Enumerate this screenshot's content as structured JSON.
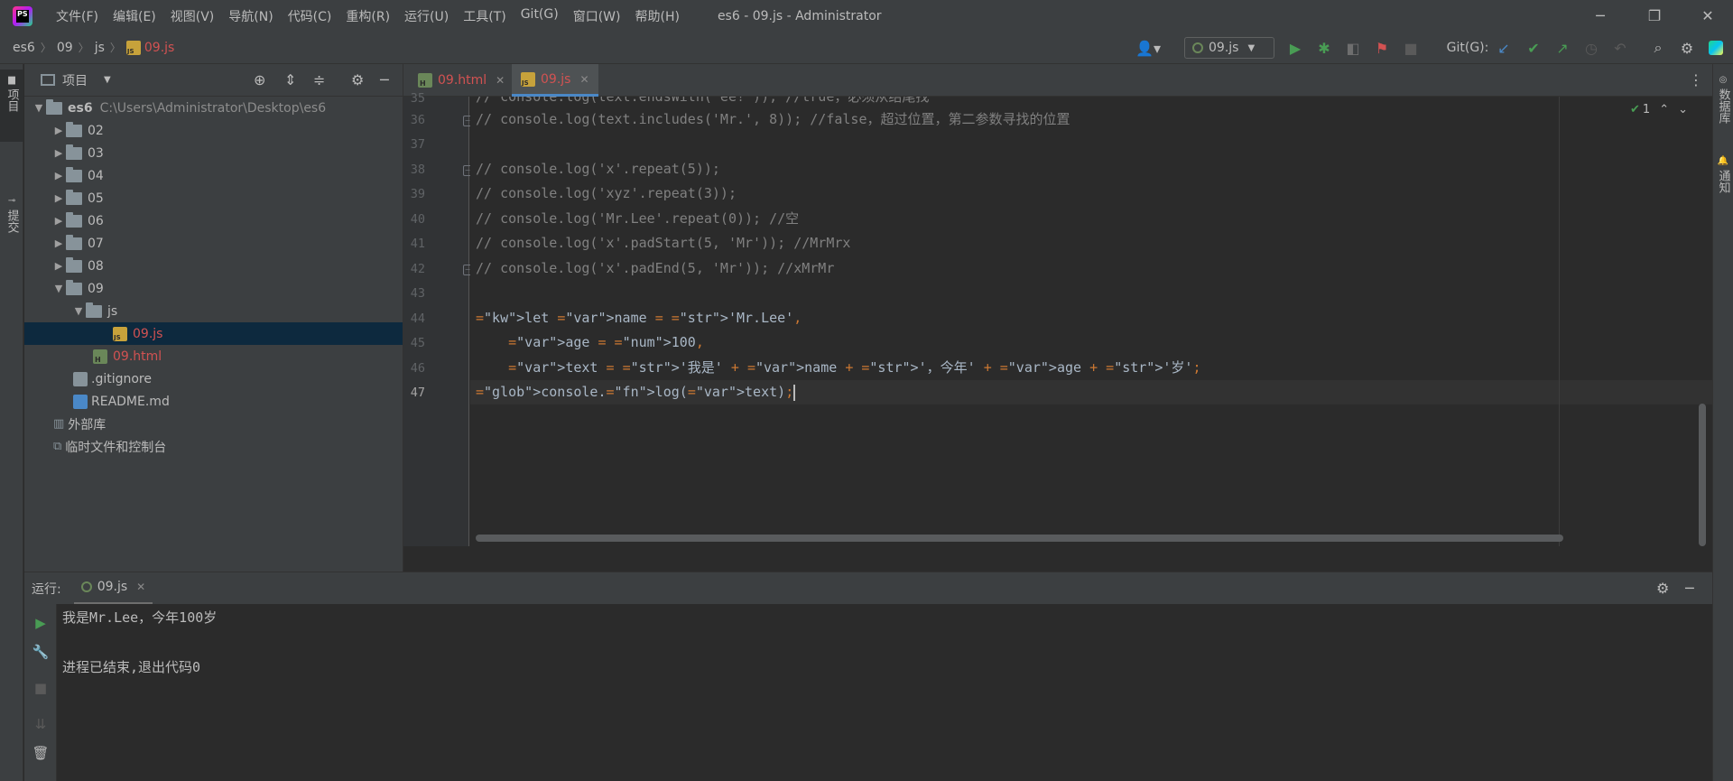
{
  "window": {
    "title": "es6 - 09.js - Administrator",
    "menu": [
      "文件(F)",
      "编辑(E)",
      "视图(V)",
      "导航(N)",
      "代码(C)",
      "重构(R)",
      "运行(U)",
      "工具(T)",
      "Git(G)",
      "窗口(W)",
      "帮助(H)"
    ],
    "controls": {
      "minimize": "─",
      "restore": "❐",
      "close": "✕"
    }
  },
  "breadcrumb": [
    "es6",
    "09",
    "js",
    "09.js"
  ],
  "toolbar": {
    "run_config": "09.js",
    "git_label": "Git(G):",
    "icons": [
      "user-icon",
      "run-icon",
      "debug-icon",
      "coverage-icon",
      "profile-icon",
      "stop-icon",
      "git-update-icon",
      "git-commit-icon",
      "git-push-icon",
      "history-icon",
      "rollback-icon",
      "search-icon",
      "settings-icon",
      "jetbrains-icon"
    ]
  },
  "left_strip": {
    "project_tab": "项目",
    "commit_tab": "提交"
  },
  "right_strip": {
    "database_tab": "数据库",
    "notifications_tab": "通知"
  },
  "project_panel": {
    "title": "项目",
    "tree": [
      {
        "label": "es6",
        "path": "C:\\Users\\Administrator\\Desktop\\es6",
        "type": "folder",
        "expanded": true,
        "depth": 0
      },
      {
        "label": "02",
        "type": "folder",
        "expanded": false,
        "depth": 1
      },
      {
        "label": "03",
        "type": "folder",
        "expanded": false,
        "depth": 1
      },
      {
        "label": "04",
        "type": "folder",
        "expanded": false,
        "depth": 1
      },
      {
        "label": "05",
        "type": "folder",
        "expanded": false,
        "depth": 1
      },
      {
        "label": "06",
        "type": "folder",
        "expanded": false,
        "depth": 1
      },
      {
        "label": "07",
        "type": "folder",
        "expanded": false,
        "depth": 1
      },
      {
        "label": "08",
        "type": "folder",
        "expanded": false,
        "depth": 1
      },
      {
        "label": "09",
        "type": "folder",
        "expanded": true,
        "depth": 1
      },
      {
        "label": "js",
        "type": "folder",
        "expanded": true,
        "depth": 2
      },
      {
        "label": "09.js",
        "type": "js",
        "depth": 3,
        "selected": true
      },
      {
        "label": "09.html",
        "type": "html",
        "depth": 2
      },
      {
        "label": ".gitignore",
        "type": "file",
        "depth": 1
      },
      {
        "label": "README.md",
        "type": "md",
        "depth": 1
      },
      {
        "label": "外部库",
        "type": "library",
        "depth": 0
      },
      {
        "label": "临时文件和控制台",
        "type": "scratch",
        "depth": 0
      }
    ]
  },
  "editor": {
    "tabs": [
      {
        "label": "09.html",
        "type": "html",
        "active": false
      },
      {
        "label": "09.js",
        "type": "js",
        "active": true
      }
    ],
    "inspection_count": "1",
    "line_numbers": [
      "35",
      "36",
      "37",
      "38",
      "39",
      "40",
      "41",
      "42",
      "43",
      "44",
      "45",
      "46",
      "47"
    ],
    "lines": [
      "// console.log(text.endsWith('ee!')); //true，必须从结尾找",
      "// console.log(text.includes('Mr.', 8)); //false，超过位置，第二参数寻找的位置",
      "",
      "// console.log('x'.repeat(5));",
      "// console.log('xyz'.repeat(3));",
      "// console.log('Mr.Lee'.repeat(0)); //空",
      "// console.log('x'.padStart(5, 'Mr')); //MrMrx",
      "// console.log('x'.padEnd(5, 'Mr')); //xMrMr",
      "",
      "let name = 'Mr.Lee',",
      "    age = 100,",
      "    text = '我是' + name + '，今年' + age + '岁';",
      "console.log(text);"
    ],
    "current_line": "47"
  },
  "run_panel": {
    "label": "运行:",
    "tab": "09.js",
    "output": [
      "我是Mr.Lee，今年100岁",
      "",
      "进程已结束,退出代码0"
    ]
  },
  "colors": {
    "background": "#2b2b2b",
    "panel": "#3c3f41",
    "accent": "#4a88c7",
    "selection": "#0d293e",
    "run_green": "#499c54",
    "file_red": "#d25252"
  }
}
